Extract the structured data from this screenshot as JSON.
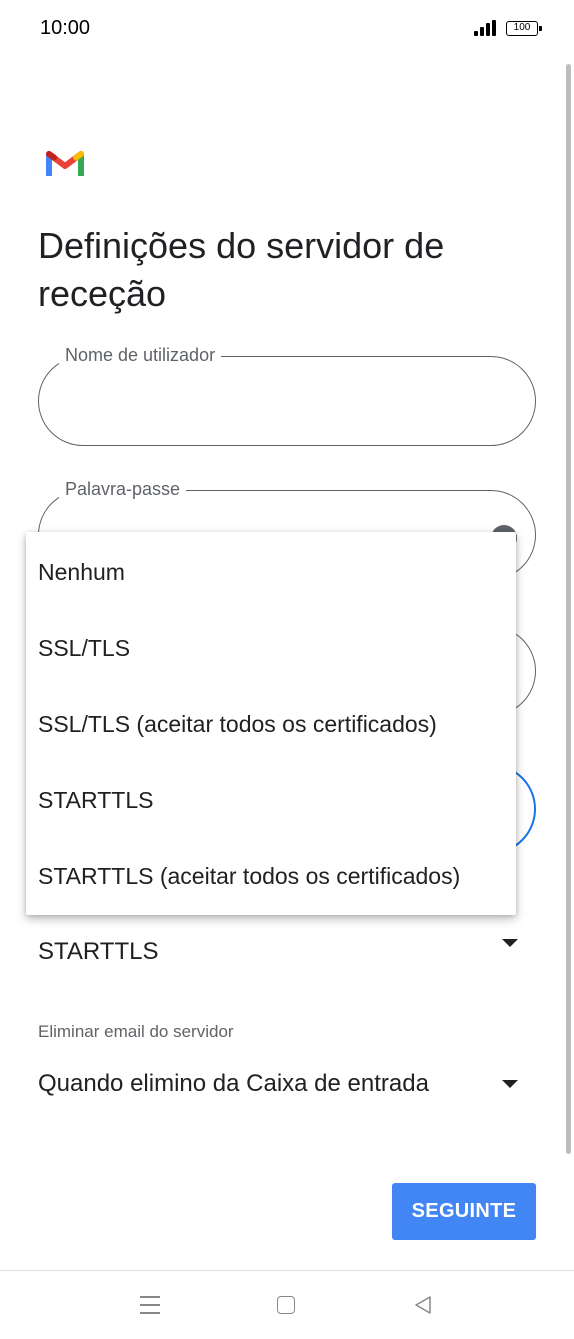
{
  "status_bar": {
    "time": "10:00",
    "battery": "100"
  },
  "page": {
    "title": "Definições do servidor de receção"
  },
  "fields": {
    "username": {
      "label": "Nome de utilizador",
      "value": ""
    },
    "password": {
      "label": "Palavra-passe",
      "value": ""
    }
  },
  "security_menu": {
    "options": [
      "Nenhum",
      "SSL/TLS",
      "SSL/TLS (aceitar todos os certificados)",
      "STARTTLS",
      "STARTTLS (aceitar todos os certificados)"
    ]
  },
  "security_type": {
    "selected": "STARTTLS"
  },
  "delete_email": {
    "label": "Eliminar email do servidor",
    "selected": "Quando elimino da Caixa de entrada"
  },
  "actions": {
    "next_label": "SEGUINTE"
  },
  "colors": {
    "accent": "#4285f4",
    "focus": "#1a73e8"
  },
  "icons": {
    "logo": "gmail-logo",
    "password_toggle": "visibility-icon",
    "nav": [
      "menu-icon",
      "home-icon",
      "back-icon"
    ]
  }
}
